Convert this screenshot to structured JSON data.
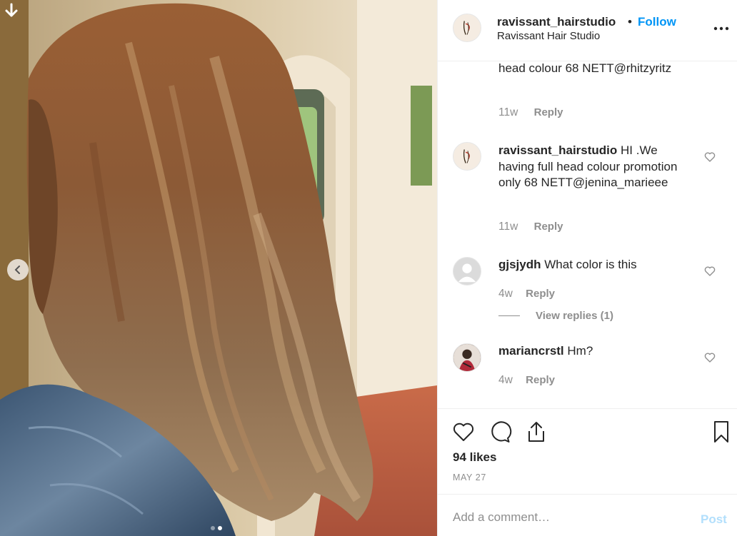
{
  "post": {
    "username": "ravissant_hairstudio",
    "separator": "•",
    "follow_label": "Follow",
    "location": "Ravissant Hair Studio",
    "more_icon": "more-horizontal-icon"
  },
  "comments": [
    {
      "username": "",
      "text": "head colour 68 NETT@rhitzyritz",
      "time": "11w",
      "reply_label": "Reply"
    },
    {
      "username": "ravissant_hairstudio",
      "text": " HI .We having full head colour promotion only 68 NETT@jenina_marieee",
      "time": "11w",
      "reply_label": "Reply"
    },
    {
      "username": "gjsjydh",
      "text": " What color is this",
      "time": "4w",
      "reply_label": "Reply",
      "view_replies": "View replies (1)"
    },
    {
      "username": "mariancrstl",
      "text": " Hm?",
      "time": "4w",
      "reply_label": "Reply"
    }
  ],
  "actions": {
    "likes": "94 likes",
    "date": "MAY 27"
  },
  "add_comment": {
    "placeholder": "Add a comment…",
    "post_label": "Post"
  },
  "colors": {
    "accent": "#0095f6",
    "post_disabled": "#b2dffc",
    "muted": "#8e8e8e",
    "text": "#262626"
  },
  "carousel": {
    "slide_count": 2,
    "active_slide": 2
  }
}
